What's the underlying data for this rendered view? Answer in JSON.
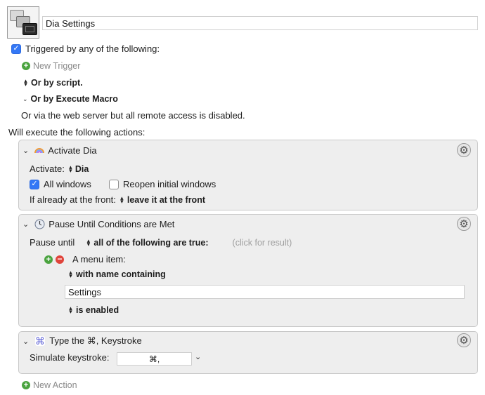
{
  "macro": {
    "name": "Dia Settings"
  },
  "triggers": {
    "triggered_label": "Triggered by any of the following:",
    "new_trigger": "New Trigger",
    "or_by_script": "Or by script.",
    "or_by_execute_macro": "Or by Execute Macro",
    "web_server_note": "Or via the web server but all remote access is disabled."
  },
  "actions_header": "Will execute the following actions:",
  "actions": [
    {
      "title": "Activate Dia",
      "activate_label": "Activate:",
      "activate_value": "Dia",
      "all_windows": "All windows",
      "reopen_windows": "Reopen initial windows",
      "if_front_label": "If already at the front:",
      "if_front_value": "leave it at the front"
    },
    {
      "title": "Pause Until Conditions are Met",
      "pause_until_label": "Pause until",
      "conditions_value": "all of the following are true:",
      "click_result": "(click for result)",
      "menu_item_label": "A menu item:",
      "name_containing": "with name containing",
      "menu_name_value": "Settings",
      "state_value": "is enabled"
    },
    {
      "title": "Type the ⌘, Keystroke",
      "simulate_label": "Simulate keystroke:",
      "keystroke_value": "⌘,"
    }
  ],
  "new_action": "New Action",
  "colors": {
    "accent_blue": "#3478f6",
    "add_green": "#4aa33f",
    "remove_red": "#e0443b",
    "action_bg": "#eeeeee"
  }
}
